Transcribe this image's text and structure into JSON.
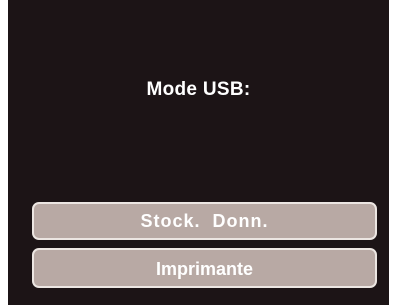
{
  "screen": {
    "title": "Mode USB:",
    "background_color": "#1c1416",
    "button_color": "#b8a9a4"
  },
  "menu": {
    "items": [
      {
        "label": "Stock.  Donn."
      },
      {
        "label": "Imprimante"
      }
    ]
  }
}
